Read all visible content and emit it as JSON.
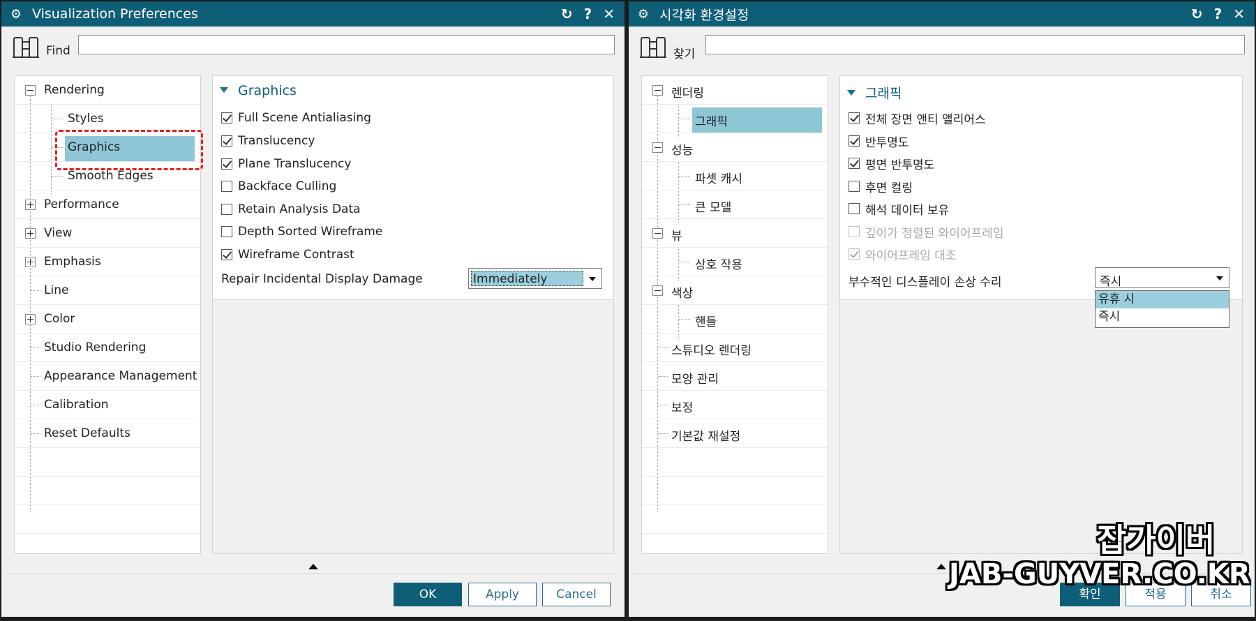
{
  "left": {
    "title": "Visualization Preferences",
    "find_label": "Find",
    "find_value": "",
    "tree": [
      {
        "label": "Rendering",
        "level": 0,
        "expander": "minus"
      },
      {
        "label": "Styles",
        "level": 1
      },
      {
        "label": "Graphics",
        "level": 1,
        "selected": true
      },
      {
        "label": "Smooth Edges",
        "level": 1
      },
      {
        "label": "Performance",
        "level": 0,
        "expander": "plus"
      },
      {
        "label": "View",
        "level": 0,
        "expander": "plus"
      },
      {
        "label": "Emphasis",
        "level": 0,
        "expander": "plus"
      },
      {
        "label": "Line",
        "level": 0
      },
      {
        "label": "Color",
        "level": 0,
        "expander": "plus"
      },
      {
        "label": "Studio Rendering",
        "level": 0
      },
      {
        "label": "Appearance Management",
        "level": 0
      },
      {
        "label": "Calibration",
        "level": 0
      },
      {
        "label": "Reset Defaults",
        "level": 0
      }
    ],
    "section": "Graphics",
    "options": [
      {
        "label": "Full Scene Antialiasing",
        "checked": true
      },
      {
        "label": "Translucency",
        "checked": true
      },
      {
        "label": "Plane Translucency",
        "checked": true
      },
      {
        "label": "Backface Culling",
        "checked": false
      },
      {
        "label": "Retain Analysis Data",
        "checked": false
      },
      {
        "label": "Depth Sorted Wireframe",
        "checked": false
      },
      {
        "label": "Wireframe Contrast",
        "checked": true
      }
    ],
    "repair_label": "Repair Incidental Display Damage",
    "repair_value": "Immediately",
    "buttons": {
      "ok": "OK",
      "apply": "Apply",
      "cancel": "Cancel"
    }
  },
  "right": {
    "title": "시각화 환경설정",
    "find_label": "찾기",
    "find_value": "",
    "tree": [
      {
        "label": "렌더링",
        "level": 0,
        "expander": "minus"
      },
      {
        "label": "그래픽",
        "level": 1,
        "selected": true
      },
      {
        "label": "성능",
        "level": 0,
        "expander": "minus"
      },
      {
        "label": "파셋 캐시",
        "level": 1
      },
      {
        "label": "큰 모델",
        "level": 1
      },
      {
        "label": "뷰",
        "level": 0,
        "expander": "minus"
      },
      {
        "label": "상호 작용",
        "level": 1
      },
      {
        "label": "색상",
        "level": 0,
        "expander": "minus"
      },
      {
        "label": "핸들",
        "level": 1
      },
      {
        "label": "스튜디오 렌더링",
        "level": 0
      },
      {
        "label": "모양 관리",
        "level": 0
      },
      {
        "label": "보정",
        "level": 0
      },
      {
        "label": "기본값 재설정",
        "level": 0
      }
    ],
    "section": "그래픽",
    "options": [
      {
        "label": "전체 장면 앤티 앨리어스",
        "checked": true
      },
      {
        "label": "반투명도",
        "checked": true
      },
      {
        "label": "평면 반투명도",
        "checked": true
      },
      {
        "label": "후면 컬링",
        "checked": false
      },
      {
        "label": "해석 데이터 보유",
        "checked": false
      },
      {
        "label": "깊이가 정렬된 와이어프레임",
        "checked": false,
        "disabled": true
      },
      {
        "label": "와이어프레임 대조",
        "checked": true,
        "disabled": true
      }
    ],
    "repair_label": "부수적인 디스플레이 손상 수리",
    "repair_value": "즉시",
    "dropdown_options": [
      "유휴 시",
      "즉시"
    ],
    "dropdown_active": 0,
    "buttons": {
      "ok": "확인",
      "apply": "적용",
      "cancel": "취소"
    }
  },
  "watermark": {
    "korean": "잡가이버",
    "url": "JAB-GUYVER.CO.KR"
  },
  "colors": {
    "titlebar": "#0f5e78",
    "selection": "#8ec6d6",
    "accent": "#0f5e78",
    "highlight": "#e0201e"
  },
  "icons": {
    "title": "gear-icon",
    "reset": "reset-icon",
    "help": "help-icon",
    "close": "close-icon",
    "find": "binoculars-icon",
    "collapse": "collapse-arrow-icon"
  }
}
